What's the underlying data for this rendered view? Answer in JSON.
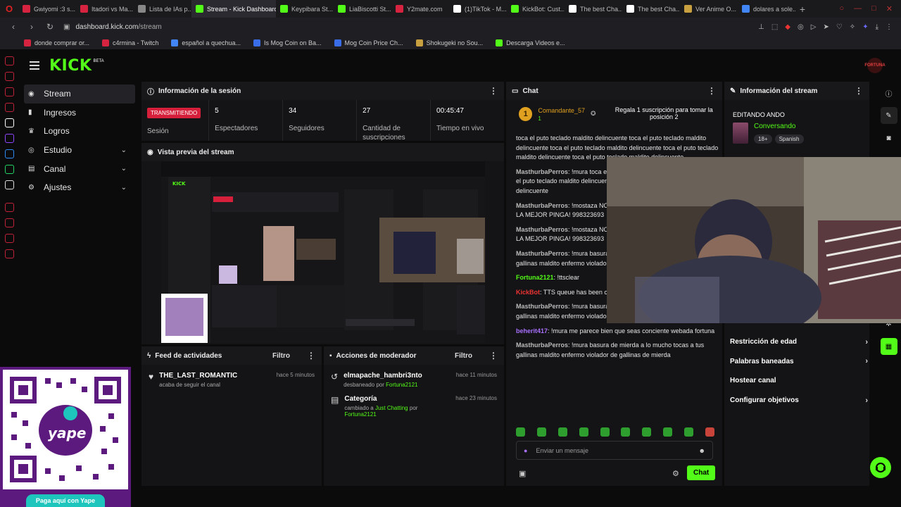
{
  "browser": {
    "tabs": [
      {
        "label": "Gwiyomi :3 s...",
        "color": "#d62340"
      },
      {
        "label": "Itadori vs Ma...",
        "color": "#d62340"
      },
      {
        "label": "Lista de IAs p...",
        "color": "#888888"
      },
      {
        "label": "Stream - Kick Dashboard",
        "color": "#53fc18",
        "active": true
      },
      {
        "label": "Keypibara St...",
        "color": "#53fc18"
      },
      {
        "label": "LiaBiscotti St...",
        "color": "#53fc18"
      },
      {
        "label": "Y2mate.com",
        "color": "#d62340"
      },
      {
        "label": "(1)TikTok - M...",
        "color": "#ffffff"
      },
      {
        "label": "KickBot: Cust...",
        "color": "#53fc18"
      },
      {
        "label": "The best Cha...",
        "color": "#ffffff"
      },
      {
        "label": "The best Cha...",
        "color": "#ffffff"
      },
      {
        "label": "Ver Anime O...",
        "color": "#c8a040"
      },
      {
        "label": "dolares a sole...",
        "color": "#4285f4"
      }
    ],
    "new_tab": "+",
    "url_host": "dashboard.kick.com",
    "url_path": "/stream",
    "bookmarks": [
      {
        "label": "donde comprar or...",
        "color": "#d62340"
      },
      {
        "label": "c4rmina - Twitch",
        "color": "#d62340"
      },
      {
        "label": "español a quechua...",
        "color": "#4285f4"
      },
      {
        "label": "Is Mog Coin on Ba...",
        "color": "#3a6ee8"
      },
      {
        "label": "Mog Coin Price Ch...",
        "color": "#3a6ee8"
      },
      {
        "label": "Shokugeki no Sou...",
        "color": "#c8a040"
      },
      {
        "label": "Descarga Videos e...",
        "color": "#53fc18"
      }
    ]
  },
  "header": {
    "logo": "KICK",
    "beta": "BETA",
    "avatar_text": "FORTUNA"
  },
  "sidebar": {
    "items": [
      {
        "label": "Stream",
        "active": true,
        "expandable": false
      },
      {
        "label": "Ingresos",
        "expandable": false
      },
      {
        "label": "Logros",
        "expandable": false
      },
      {
        "label": "Estudio",
        "expandable": true
      },
      {
        "label": "Canal",
        "expandable": true
      },
      {
        "label": "Ajustes",
        "expandable": true
      }
    ]
  },
  "session": {
    "title": "Información de la sesión",
    "badge": "TRANSMITIENDO",
    "badge_label": "Sesión",
    "stats": [
      {
        "value": "5",
        "label": "Espectadores"
      },
      {
        "value": "34",
        "label": "Seguidores"
      },
      {
        "value": "27",
        "label": "Cantidad de suscripciones"
      },
      {
        "value": "00:45:47",
        "label": "Tiempo en vivo"
      }
    ]
  },
  "preview": {
    "title": "Vista previa del stream"
  },
  "feed": {
    "title": "Feed de actividades",
    "filter": "Filtro",
    "items": [
      {
        "user": "THE_LAST_ROMANTIC",
        "action": "acaba de seguir el canal",
        "time": "hace 5 minutos"
      }
    ]
  },
  "mod": {
    "title": "Acciones de moderador",
    "filter": "Filtro",
    "items": [
      {
        "title": "elmapache_hambri3nto",
        "pre": "desbaneado por ",
        "link": "Fortuna2121",
        "time": "hace 11 minutos"
      },
      {
        "title": "Categoría",
        "pre": "cambiado a ",
        "link": "Just Chatting",
        "mid": " por ",
        "link2": "Fortuna2121",
        "time": "hace 23 minutos"
      }
    ]
  },
  "chat": {
    "title": "Chat",
    "pinned": {
      "user": "Comandante_57",
      "count": "1",
      "coin": "1",
      "message": "Regala 1 suscripción para tomar la posición 2"
    },
    "messages": [
      {
        "user": "",
        "color": "#bbbbbb",
        "text": "toca el puto teclado maldito delincuente toca el puto teclado maldito delincuente toca el puto teclado maldito delincuente toca el puto teclado maldito delincuente toca el puto teclado maldito delincuente"
      },
      {
        "user": "MasthurbaPerros",
        "color": "#bbbbbb",
        "text": "!mura toca el puto teclado maldito delincuente toca el puto teclado maldito delincuente toca el puto teclado maldito delincuente"
      },
      {
        "user": "MasthurbaPerros",
        "color": "#bbbbbb",
        "text": "!mostaza NO PINGAS A MI NUMERO YO FORMO LA MEJOR PINGA! 998323693"
      },
      {
        "user": "MasthurbaPerros",
        "color": "#bbbbbb",
        "text": "!mostaza NO PINGAS A MI NUMERO YO FORMO LA MEJOR PINGA! 998323693"
      },
      {
        "user": "MasthurbaPerros",
        "color": "#bbbbbb",
        "text": "!mura basura de mierda a lo mucho tocas a tus gallinas maldito enfermo violador de gallinas de mierda"
      },
      {
        "user": "Fortuna2121",
        "color": "#53fc18",
        "text": "!ttsclear"
      },
      {
        "user": "KickBot",
        "color": "#e33",
        "text": "TTS queue has been cleared."
      },
      {
        "user": "MasthurbaPerros",
        "color": "#bbbbbb",
        "text": "!mura basura de mierda a lo mucho tocas a tus gallinas maldito enfermo violador de gallinas de mierda"
      },
      {
        "user": "beherit417",
        "color": "#a970ff",
        "text": "!mura me parece bien que seas conciente webada fortuna"
      },
      {
        "user": "MasthurbaPerros",
        "color": "#bbbbbb",
        "text": "!mura basura de mierda a lo mucho tocas a tus gallinas maldito enfermo violador de gallinas de mierda"
      }
    ],
    "placeholder": "Enviar un mensaje",
    "send": "Chat"
  },
  "stream_info": {
    "title": "Información del stream",
    "stream_title": "EDITANDO ANDO",
    "category": "Conversando",
    "tags": [
      "18+",
      "Spanish"
    ],
    "menu": [
      "Restricción de edad",
      "Palabras baneadas",
      "Hostear canal",
      "Configurar objetivos"
    ]
  },
  "qr": {
    "brand": "yape",
    "button": "Paga aquí con Yape"
  }
}
